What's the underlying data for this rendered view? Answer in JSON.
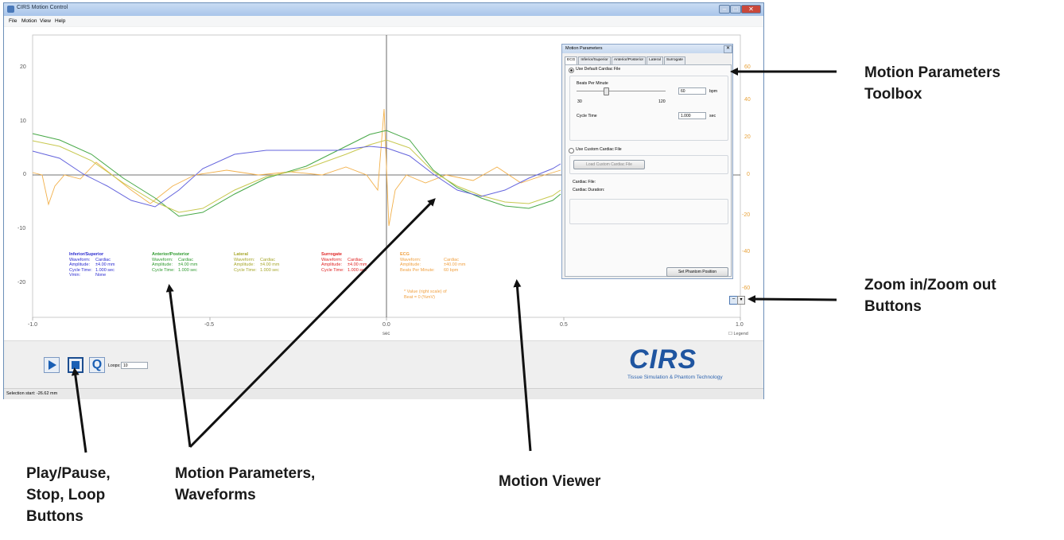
{
  "window": {
    "title": "CIRS Motion Control",
    "menu": [
      "File",
      "Motion",
      "View",
      "Help"
    ]
  },
  "plot": {
    "y_ticks": [
      "20",
      "10",
      "0",
      "-10",
      "-20"
    ],
    "x_ticks": [
      "-1.0",
      "-0.5",
      "0.0",
      "0.5",
      "1.0"
    ],
    "x_label": "sec",
    "right_ticks": [
      "60",
      "40",
      "20",
      "0",
      "-20",
      "-40",
      "-60"
    ],
    "legend_toggle": "Legend",
    "colors": {
      "blue": "#5b5bd6",
      "green": "#3aa33a",
      "yellow": "#c9c94a",
      "red": "#e23030",
      "orange": "#f0a040"
    }
  },
  "legend_blocks": [
    {
      "title": "Inferior/Superior",
      "color": "#2b2bd0",
      "rows": [
        [
          "Waveform:",
          "Cardiac"
        ],
        [
          "Amplitude:",
          "±4.00 mm"
        ],
        [
          "Cycle Time:",
          "1.000 sec"
        ],
        [
          "Vmin:",
          "None"
        ]
      ]
    },
    {
      "title": "Anterior/Posterior",
      "color": "#2f9a2f",
      "rows": [
        [
          "Waveform:",
          "Cardiac"
        ],
        [
          "Amplitude:",
          "±4.00 mm"
        ],
        [
          "Cycle Time:",
          "1.000 sec"
        ]
      ]
    },
    {
      "title": "Lateral",
      "color": "#a6a62a",
      "rows": [
        [
          "Waveform:",
          "Cardiac"
        ],
        [
          "Amplitude:",
          "±4.00 mm"
        ],
        [
          "Cycle Time:",
          "1.000 sec"
        ]
      ]
    },
    {
      "title": "Surrogate",
      "color": "#e02525",
      "rows": [
        [
          "Waveform:",
          "Cardiac"
        ],
        [
          "Amplitude:",
          "±4.00 mm"
        ],
        [
          "Cycle Time:",
          "1.000 sec"
        ]
      ]
    },
    {
      "title": "ECG",
      "color": "#f0a040",
      "rows": [
        [
          "Waveform:",
          "Cardiac"
        ],
        [
          "Amplitude:",
          "±40.00 mm"
        ],
        [
          "Beats Per Minute:",
          "60 bpm"
        ]
      ]
    }
  ],
  "ecg_note": "* Value (right scale) of Beat = 0 (%mV)",
  "toolbox": {
    "title": "Motion Parameters",
    "tabs": [
      "ECG",
      "Inferior/Superior",
      "Anterior/Posterior",
      "Lateral",
      "Surrogate"
    ],
    "use_default": "Use Default Cardiac File",
    "bpm_label": "Beats Per Minute",
    "bpm_value": "60",
    "bpm_unit": "bpm",
    "slider_min": "30",
    "slider_max": "120",
    "slider_value_fraction": 0.33,
    "cycle_label": "Cycle Time",
    "cycle_value": "1.000",
    "cycle_unit": "sec",
    "use_custom": "Use Custom Cardiac File",
    "load_button": "Load Custom Cardiac File",
    "cardiac_file": "Cardiac File:",
    "cardiac_duration": "Cardiac Duration:",
    "set_button": "Set Phantom Position"
  },
  "controls": {
    "loops_label": "Loops:",
    "loops_value": "10"
  },
  "brand": {
    "logo": "CIRS",
    "tagline": "Tissue Simulation & Phantom Technology"
  },
  "status": "Selection start: -26.62 mm",
  "annotations": {
    "toolbox": [
      "Motion Parameters",
      "Toolbox"
    ],
    "zoom": [
      "Zoom in/Zoom out",
      "Buttons"
    ],
    "play": [
      "Play/Pause,",
      "Stop, Loop",
      "Buttons"
    ],
    "params": [
      "Motion Parameters,",
      "Waveforms"
    ],
    "viewer": "Motion Viewer"
  }
}
